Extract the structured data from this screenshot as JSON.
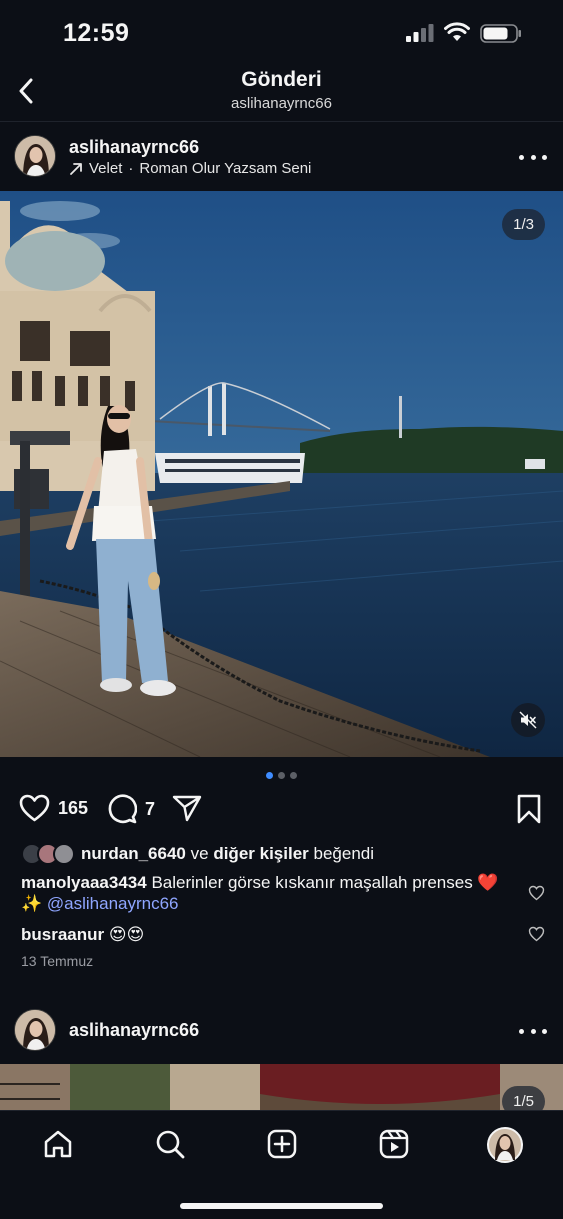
{
  "status_bar": {
    "time": "12:59"
  },
  "header": {
    "title": "Gönderi",
    "subtitle": "aslihanayrnc66"
  },
  "post": {
    "username": "aslihanayrnc66",
    "music_artist": "Velet",
    "music_separator": "·",
    "music_track": "Roman Olur Yazsam Seni",
    "image_counter": "1/3",
    "likes_count": "165",
    "comments_count": "7",
    "liked_by_user": "nurdan_6640",
    "liked_by_connector": "ve",
    "liked_by_others": "diğer kişiler",
    "liked_by_suffix": "beğendi",
    "comments": [
      {
        "user": "manolyaaa3434",
        "text": "Balerinler görse kıskanır maşallah prenses ❤️ ✨",
        "mention": "@aslihanayrnc66"
      },
      {
        "user": "busraanur",
        "text": "😍😍",
        "mention": ""
      }
    ],
    "date": "13 Temmuz",
    "carousel": {
      "total": 3,
      "active": 1
    }
  },
  "next_post": {
    "username": "aslihanayrnc66",
    "image_counter": "1/5"
  },
  "colors": {
    "background": "#0c0f16",
    "accent_dot": "#3f8cff",
    "mention": "#8fa6ff"
  },
  "icons": {
    "back": "chevron-left-icon",
    "more": "more-horizontal-icon",
    "music": "arrow-up-right-icon",
    "like": "heart-icon",
    "comment": "comment-bubble-icon",
    "share": "paper-plane-icon",
    "save": "bookmark-icon",
    "mute": "speaker-muted-icon",
    "tabs": [
      "home-icon",
      "search-icon",
      "create-plus-icon",
      "reels-icon",
      "profile-avatar-icon"
    ]
  }
}
